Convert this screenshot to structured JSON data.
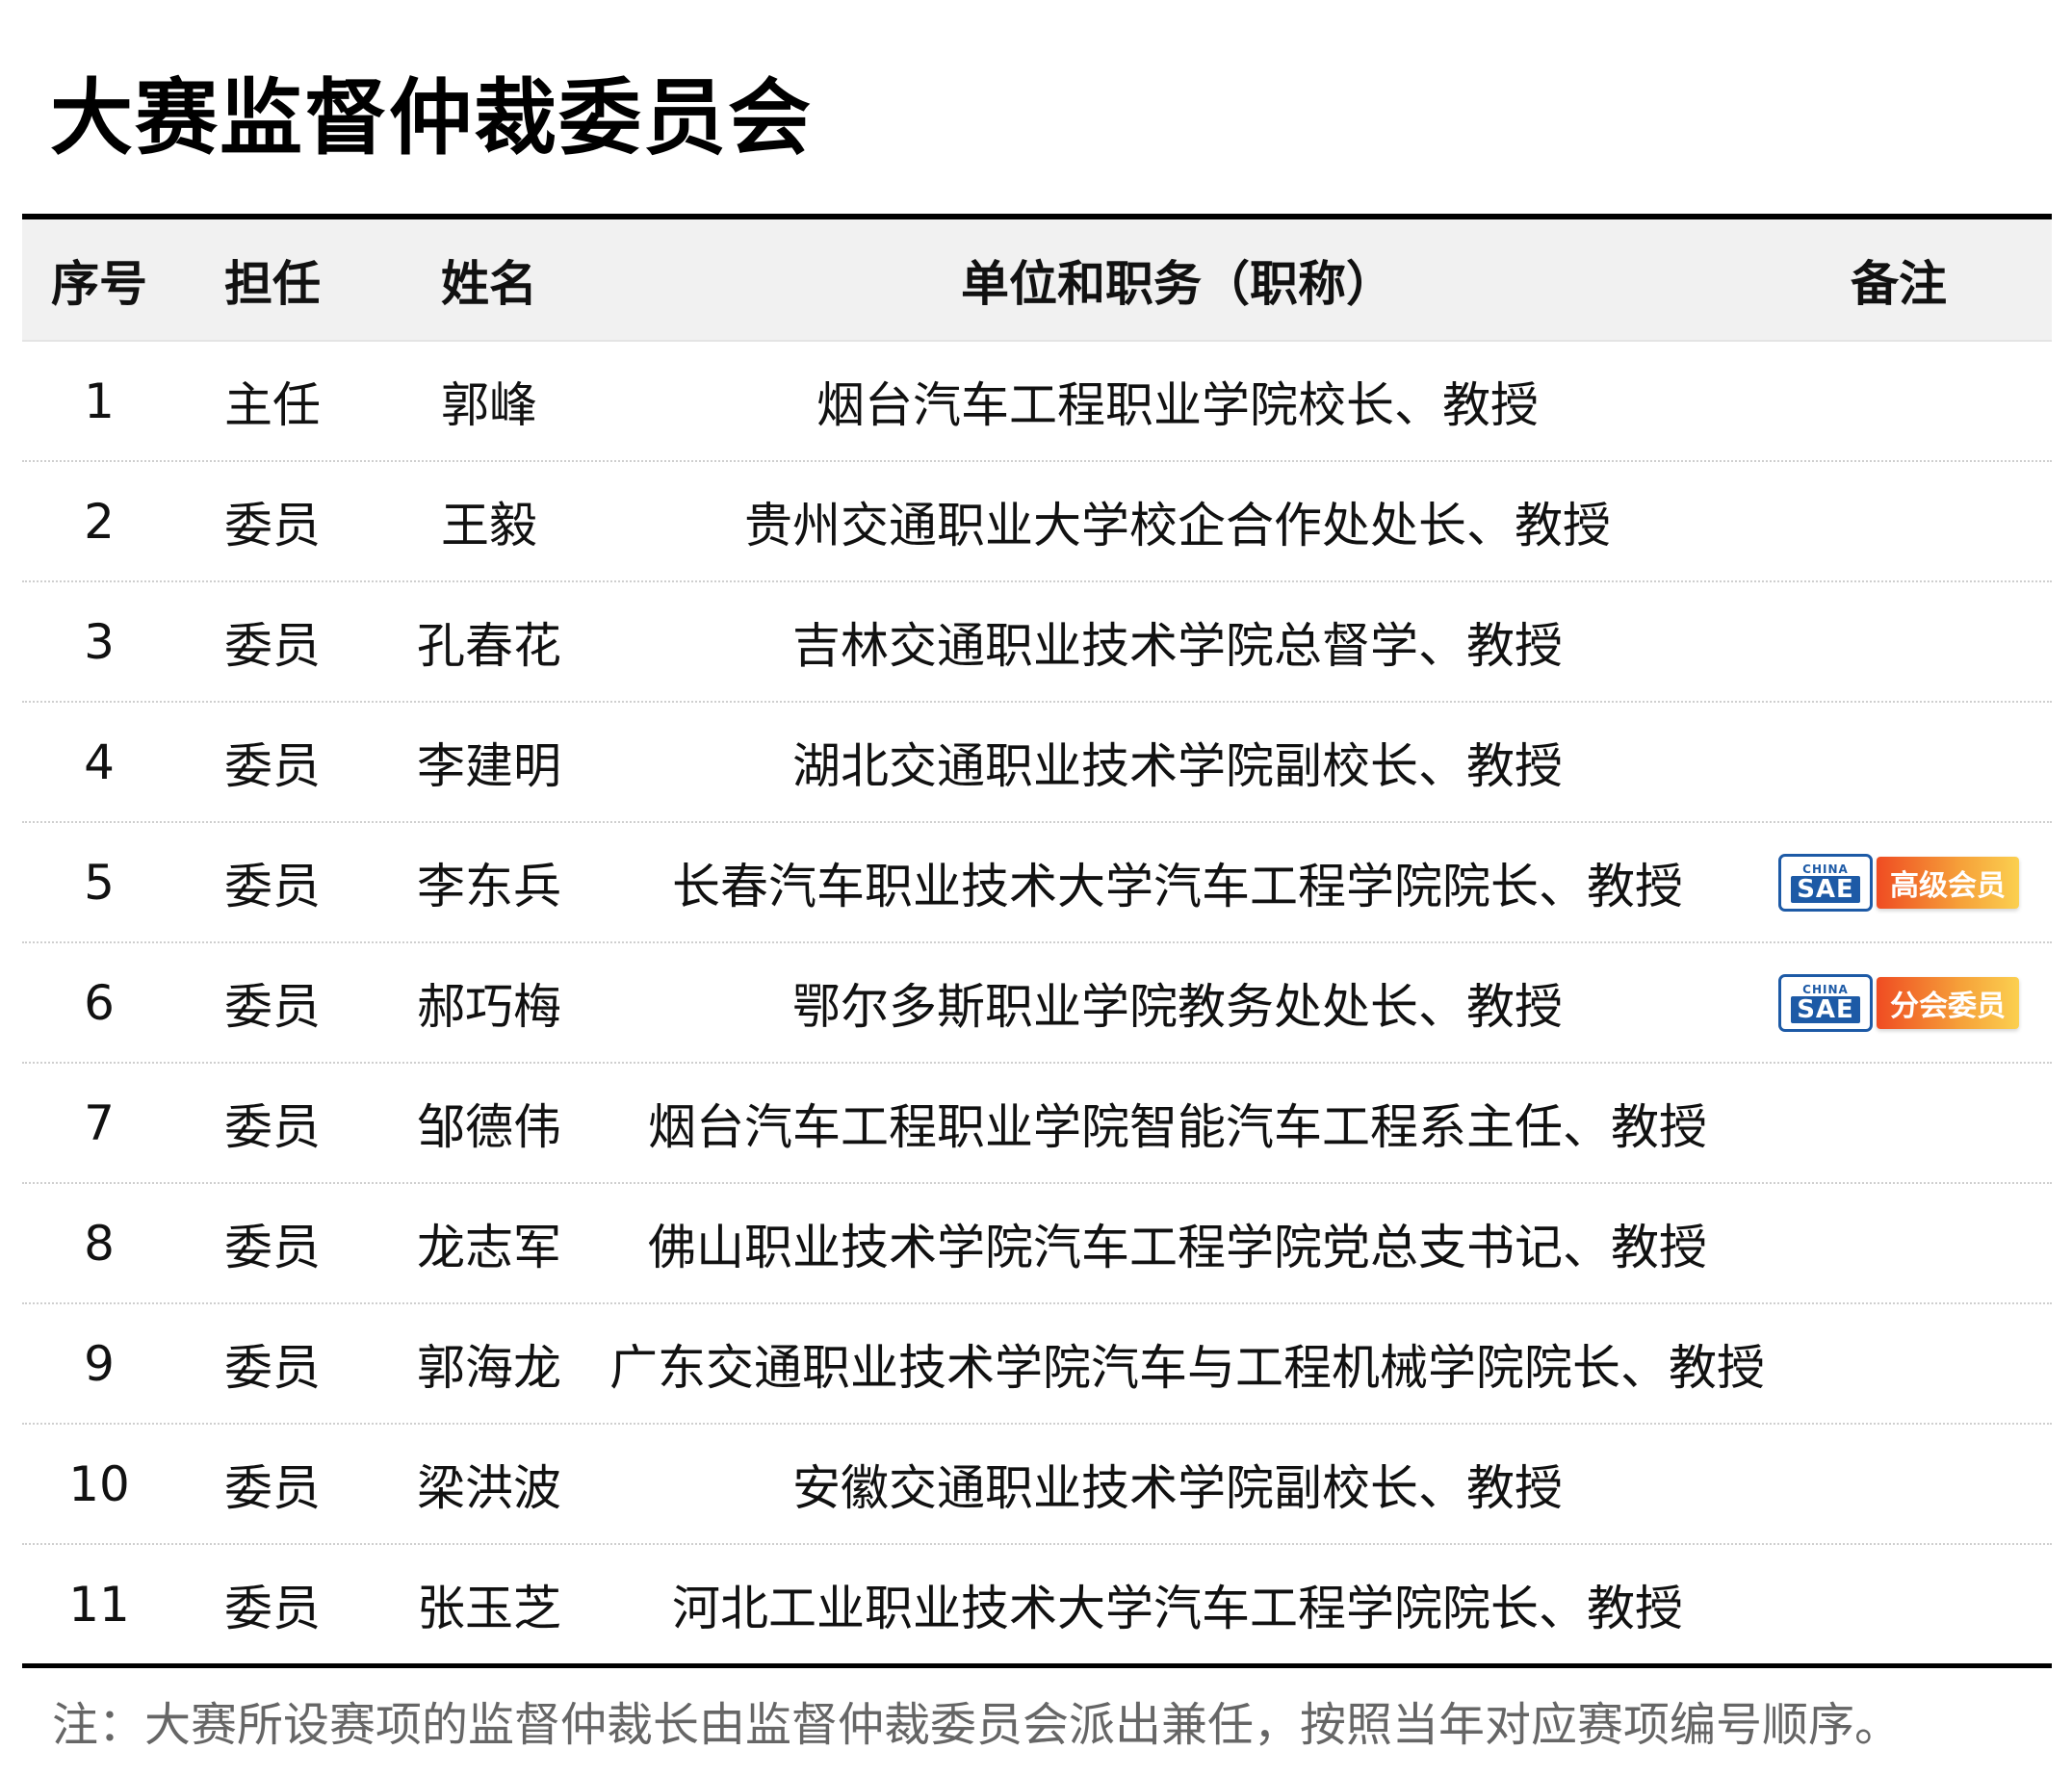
{
  "title": "大赛监督仲裁委员会",
  "headers": {
    "idx": "序号",
    "role": "担任",
    "name": "姓名",
    "unit": "单位和职务（职称）",
    "note": "备注"
  },
  "rows": [
    {
      "idx": "1",
      "role": "主任",
      "name": "郭峰",
      "unit": "烟台汽车工程职业学院校长、教授"
    },
    {
      "idx": "2",
      "role": "委员",
      "name": "王毅",
      "unit": "贵州交通职业大学校企合作处处长、教授"
    },
    {
      "idx": "3",
      "role": "委员",
      "name": "孔春花",
      "unit": "吉林交通职业技术学院总督学、教授"
    },
    {
      "idx": "4",
      "role": "委员",
      "name": "李建明",
      "unit": "湖北交通职业技术学院副校长、教授"
    },
    {
      "idx": "5",
      "role": "委员",
      "name": "李东兵",
      "unit": "长春汽车职业技术大学汽车工程学院院长、教授",
      "badge": {
        "logo_top": "CHINA",
        "logo_main": "SAE",
        "text": "高级会员"
      }
    },
    {
      "idx": "6",
      "role": "委员",
      "name": "郝巧梅",
      "unit": "鄂尔多斯职业学院教务处处长、教授",
      "badge": {
        "logo_top": "CHINA",
        "logo_main": "SAE",
        "text": "分会委员"
      }
    },
    {
      "idx": "7",
      "role": "委员",
      "name": "邹德伟",
      "unit": "烟台汽车工程职业学院智能汽车工程系主任、教授"
    },
    {
      "idx": "8",
      "role": "委员",
      "name": "龙志军",
      "unit": "佛山职业技术学院汽车工程学院党总支书记、教授"
    },
    {
      "idx": "9",
      "role": "委员",
      "name": "郭海龙",
      "unit": "广东交通职业技术学院汽车与工程机械学院院长、教授"
    },
    {
      "idx": "10",
      "role": "委员",
      "name": "梁洪波",
      "unit": "安徽交通职业技术学院副校长、教授"
    },
    {
      "idx": "11",
      "role": "委员",
      "name": "张玉芝",
      "unit": "河北工业职业技术大学汽车工程学院院长、教授"
    }
  ],
  "footnote": "注：大赛所设赛项的监督仲裁长由监督仲裁委员会派出兼任，按照当年对应赛项编号顺序。",
  "colors": {
    "sae_blue": "#1d5aa6",
    "badge_orange": "#ef4c22",
    "badge_yellow": "#fbd050"
  }
}
